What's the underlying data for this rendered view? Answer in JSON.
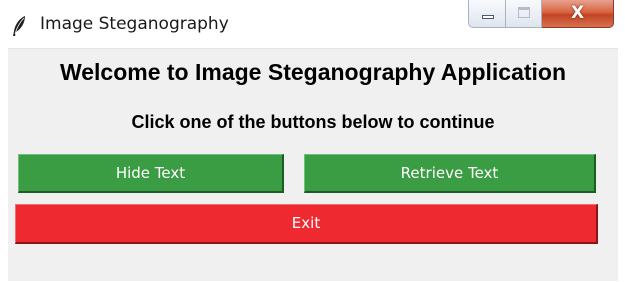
{
  "window": {
    "title": "Image Steganography",
    "icon": "feather-icon",
    "controls": {
      "minimize_icon": "minimize-icon",
      "maximize_icon": "maximize-icon",
      "close_glyph": "X"
    }
  },
  "main": {
    "heading": "Welcome to Image Steganography Application",
    "subheading": "Click one of the buttons below to continue",
    "buttons": {
      "hide_text": "Hide Text",
      "retrieve_text": "Retrieve Text",
      "exit": "Exit"
    }
  },
  "colors": {
    "primary_button": "#3a9c43",
    "exit_button": "#ee2a30",
    "client_background": "#f0f0f0"
  }
}
